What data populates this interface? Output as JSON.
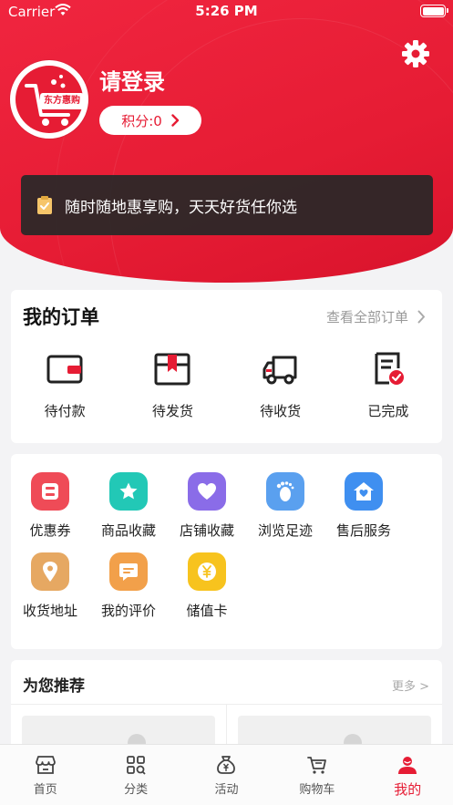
{
  "status_bar": {
    "carrier": "Carrier",
    "time": "5:26 PM"
  },
  "profile": {
    "logo_text": "东方惠购",
    "login_text": "请登录",
    "points_label": "积分:0"
  },
  "notice": {
    "text": "随时随地惠享购，天天好货任你选"
  },
  "orders": {
    "title": "我的订单",
    "view_all": "查看全部订单",
    "items": [
      {
        "label": "待付款",
        "icon": "wallet-icon"
      },
      {
        "label": "待发货",
        "icon": "package-icon"
      },
      {
        "label": "待收货",
        "icon": "truck-icon"
      },
      {
        "label": "已完成",
        "icon": "document-check-icon"
      }
    ]
  },
  "services": {
    "items": [
      {
        "label": "优惠券",
        "icon": "coupon-icon",
        "color": "#ef4b57"
      },
      {
        "label": "商品收藏",
        "icon": "star-icon",
        "color": "#22c8b6"
      },
      {
        "label": "店铺收藏",
        "icon": "heart-icon",
        "color": "#8a6ce8"
      },
      {
        "label": "浏览足迹",
        "icon": "footprint-icon",
        "color": "#5aa0ef"
      },
      {
        "label": "售后服务",
        "icon": "house-heart-icon",
        "color": "#3f8ff0"
      },
      {
        "label": "收货地址",
        "icon": "location-pin-icon",
        "color": "#e6a862"
      },
      {
        "label": "我的评价",
        "icon": "comment-icon",
        "color": "#f2a04a"
      },
      {
        "label": "储值卡",
        "icon": "yen-coin-icon",
        "color": "#f7c31e"
      }
    ]
  },
  "recommend": {
    "title": "为您推荐",
    "more": "更多 >"
  },
  "tabbar": {
    "items": [
      {
        "label": "首页",
        "icon": "home-store-icon"
      },
      {
        "label": "分类",
        "icon": "category-grid-icon"
      },
      {
        "label": "活动",
        "icon": "money-bag-icon"
      },
      {
        "label": "购物车",
        "icon": "cart-icon"
      },
      {
        "label": "我的",
        "icon": "user-icon"
      }
    ],
    "active_index": 4
  },
  "colors": {
    "brand_red": "#e61c34",
    "page_bg": "#f3f3f5"
  }
}
